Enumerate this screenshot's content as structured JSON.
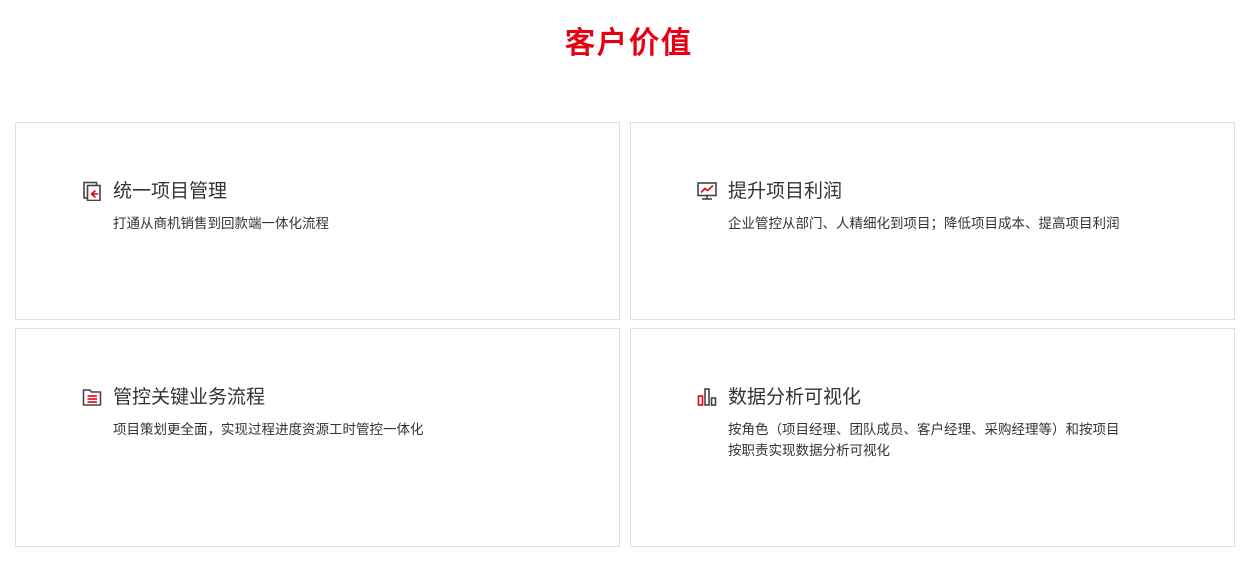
{
  "section": {
    "title": "客户价值",
    "title_color": "#e60012"
  },
  "colors": {
    "accent": "#e60012",
    "icon_dark": "#444444",
    "card_border": "#dedede"
  },
  "cards": [
    {
      "icon": "document-arrow-icon",
      "title": "统一项目管理",
      "desc_lines": [
        "打通从商机销售到回款端一体化流程"
      ]
    },
    {
      "icon": "monitor-chart-icon",
      "title": "提升项目利润",
      "desc_lines": [
        "企业管控从部门、人精细化到项目；降低项目成本、提高项目利润"
      ]
    },
    {
      "icon": "folder-list-icon",
      "title": "管控关键业务流程",
      "desc_lines": [
        "项目策划更全面，实现过程进度资源工时管控一体化"
      ]
    },
    {
      "icon": "bar-chart-icon",
      "title": "数据分析可视化",
      "desc_lines": [
        "按角色（项目经理、团队成员、客户经理、采购经理等）和按项目",
        "按职责实现数据分析可视化"
      ]
    }
  ]
}
